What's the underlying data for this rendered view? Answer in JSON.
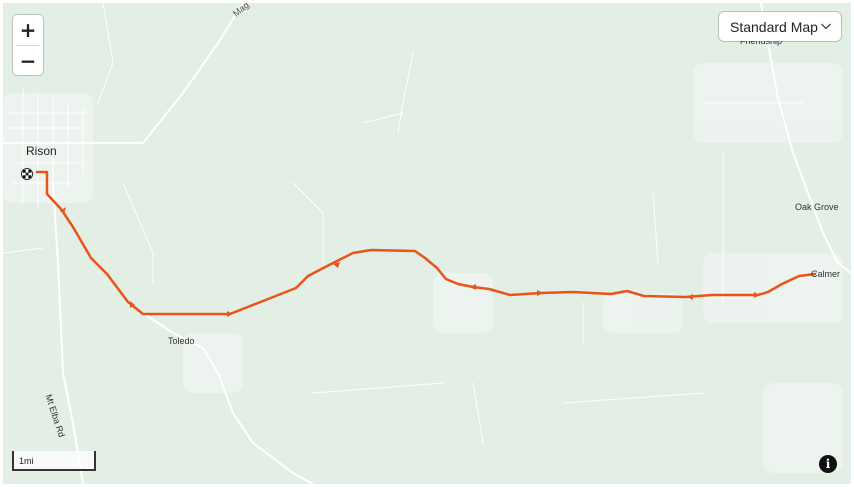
{
  "map_style": {
    "selected": "Standard Map"
  },
  "zoom": {
    "in_label": "+",
    "out_label": "−"
  },
  "places": {
    "rison": "Rison",
    "toledo": "Toledo",
    "friendship": "Friendship",
    "oak_grove": "Oak Grove",
    "calmer": "Calmer"
  },
  "roads": {
    "mt_elba_rd": "Mt Elba Rd",
    "mag": "Mag"
  },
  "scale_bar": {
    "label": "1mi"
  },
  "info_button": {
    "label": "i"
  },
  "route": {
    "color": "#e8541a",
    "start_marker": "checkered-flag-icon"
  },
  "colors": {
    "land": "#e3eee5",
    "road": "#ffffff",
    "route": "#e8541a"
  }
}
